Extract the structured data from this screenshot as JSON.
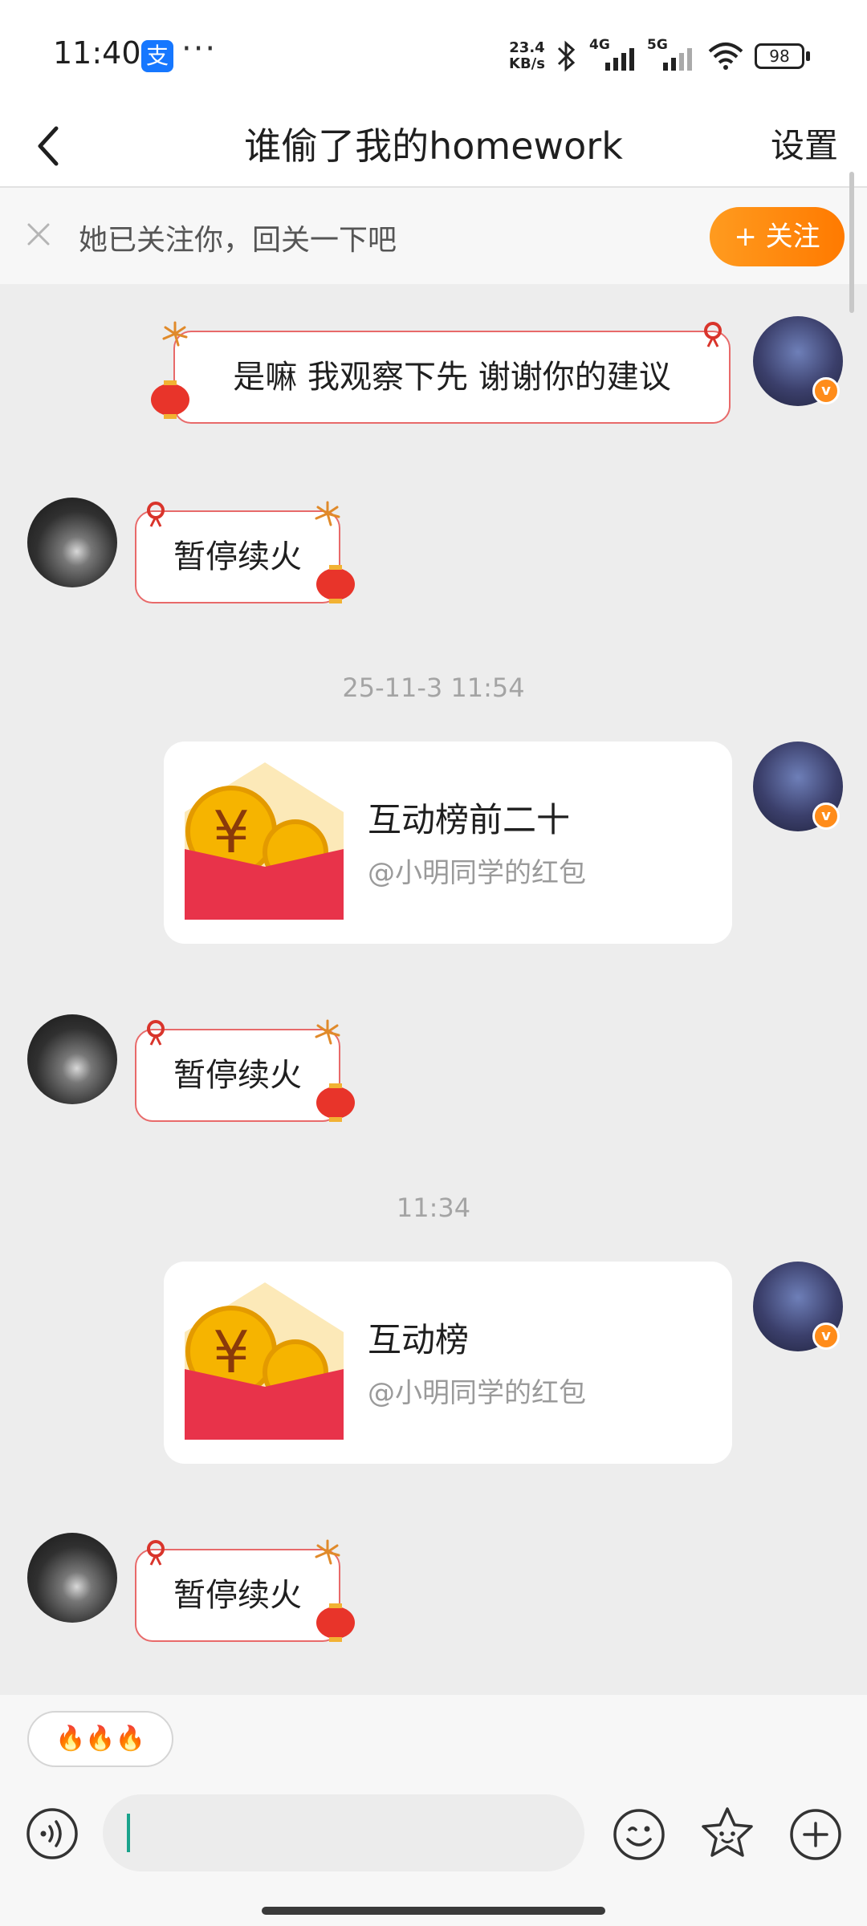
{
  "status_bar": {
    "time": "11:40",
    "alipay_badge": "支",
    "more": "···",
    "net_speed_value": "23.4",
    "net_speed_unit": "KB/s",
    "signal_1": "4G",
    "signal_2": "5G",
    "battery": "98"
  },
  "header": {
    "title": "谁偷了我的homework",
    "settings_label": "设置"
  },
  "follow_banner": {
    "text": "她已关注你，回关一下吧",
    "button_label": "+ 关注",
    "accent_color": "#ff8a00"
  },
  "messages": [
    {
      "sender": "self",
      "type": "text",
      "text": "是嘛  我观察下先 谢谢你的建议"
    },
    {
      "sender": "other",
      "type": "text",
      "text": "暂停续火"
    },
    {
      "type": "timestamp",
      "text": "25-11-3 11:54"
    },
    {
      "sender": "self",
      "type": "red_packet",
      "title": "互动榜前二十",
      "subtitle": "@小明同学的红包"
    },
    {
      "sender": "other",
      "type": "text",
      "text": "暂停续火"
    },
    {
      "type": "timestamp",
      "text": "11:34"
    },
    {
      "sender": "self",
      "type": "red_packet",
      "title": "互动榜",
      "subtitle": "@小明同学的红包"
    },
    {
      "sender": "other",
      "type": "text",
      "text": "暂停续火"
    }
  ],
  "avatars": {
    "verified_mark": "v"
  },
  "icons": {
    "back": "back-arrow-icon",
    "close": "close-icon",
    "lantern": "lantern-icon",
    "red_packet": "red-packet-icon",
    "voice": "voice-icon",
    "emoji": "emoji-icon",
    "sticker": "sticker-icon",
    "plus": "plus-icon"
  },
  "quick_reply": {
    "label": "🔥🔥🔥"
  },
  "input": {
    "placeholder": ""
  },
  "colors": {
    "bubble_border": "#e86a6a",
    "red_packet": "#e8334a",
    "coin": "#f6b400",
    "background": "#ededed"
  }
}
